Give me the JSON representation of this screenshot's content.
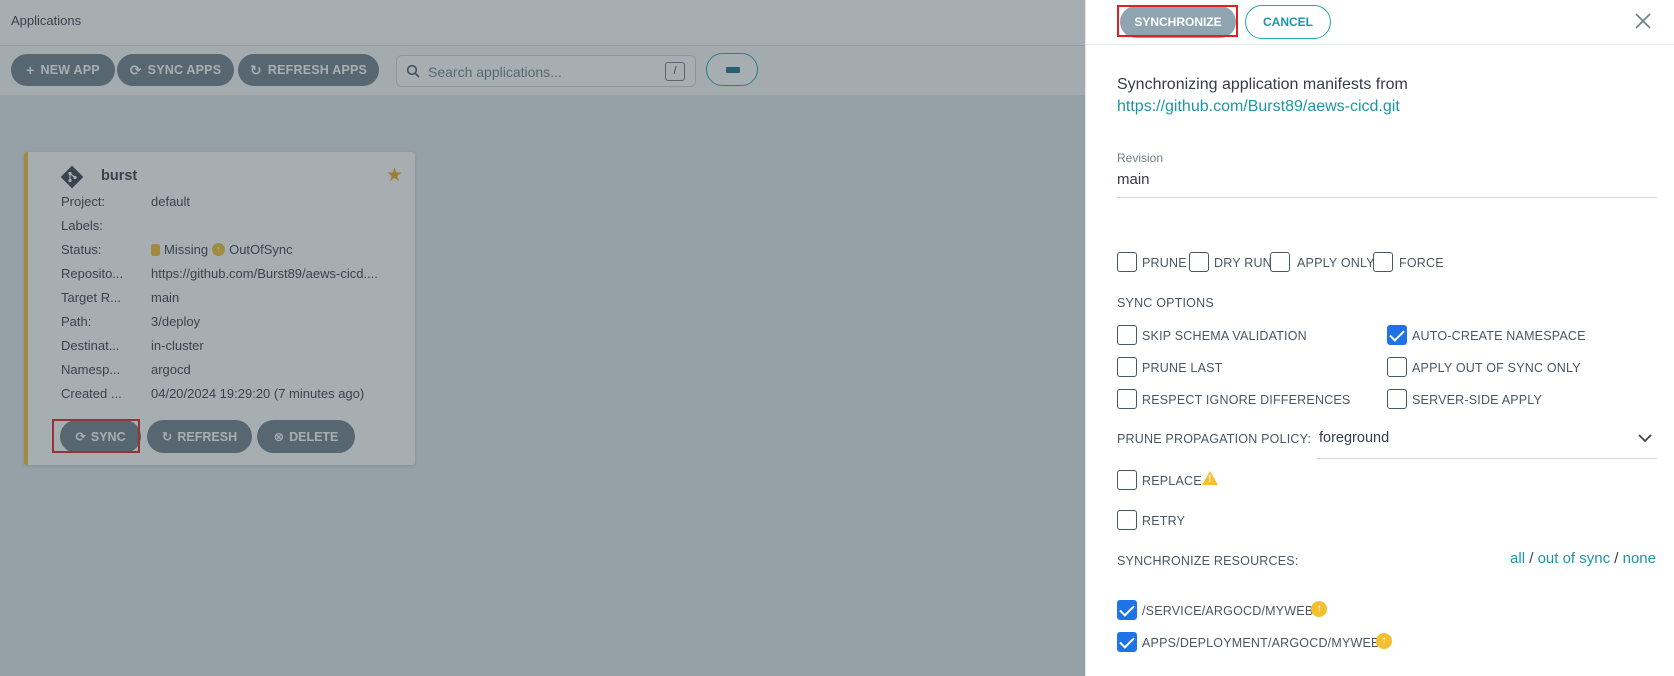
{
  "header": {
    "title": "Applications"
  },
  "toolbar": {
    "new_app": "NEW APP",
    "sync_apps": "SYNC APPS",
    "refresh_apps": "REFRESH APPS",
    "search_placeholder": "Search applications...",
    "search_shortcut": "/"
  },
  "app_card": {
    "name": "burst",
    "fields": [
      {
        "key": "Project:",
        "value": "default"
      },
      {
        "key": "Labels:",
        "value": ""
      },
      {
        "key": "Status:",
        "value": ""
      },
      {
        "key": "Reposito...",
        "value": "https://github.com/Burst89/aews-cicd...."
      },
      {
        "key": "Target R...",
        "value": "main"
      },
      {
        "key": "Path:",
        "value": "3/deploy"
      },
      {
        "key": "Destinat...",
        "value": "in-cluster"
      },
      {
        "key": "Namesp...",
        "value": "argocd"
      },
      {
        "key": "Created ...",
        "value": "04/20/2024 19:29:20  (7 minutes ago)"
      }
    ],
    "health_status": "Missing",
    "sync_status": "OutOfSync",
    "buttons": {
      "sync": "SYNC",
      "refresh": "REFRESH",
      "delete": "DELETE"
    }
  },
  "panel": {
    "synchronize": "SYNCHRONIZE",
    "cancel": "CANCEL",
    "intro": "Synchronizing application manifests from",
    "repo_url": "https://github.com/Burst89/aews-cicd.git",
    "revision_label": "Revision",
    "revision_value": "main",
    "top_options": [
      {
        "label": "PRUNE",
        "checked": false
      },
      {
        "label": "DRY RUN",
        "checked": false
      },
      {
        "label": "APPLY ONLY",
        "checked": false
      },
      {
        "label": "FORCE",
        "checked": false
      }
    ],
    "sync_options_title": "SYNC OPTIONS",
    "sync_options": [
      {
        "label": "SKIP SCHEMA VALIDATION",
        "checked": false
      },
      {
        "label": "AUTO-CREATE NAMESPACE",
        "checked": true
      },
      {
        "label": "PRUNE LAST",
        "checked": false
      },
      {
        "label": "APPLY OUT OF SYNC ONLY",
        "checked": false
      },
      {
        "label": "RESPECT IGNORE DIFFERENCES",
        "checked": false
      },
      {
        "label": "SERVER-SIDE APPLY",
        "checked": false
      }
    ],
    "prune_policy_label": "PRUNE PROPAGATION POLICY:",
    "prune_policy_value": "foreground",
    "replace_label": "REPLACE",
    "retry_label": "RETRY",
    "sync_resources_label": "SYNCHRONIZE RESOURCES:",
    "select_links": {
      "all": "all",
      "sep1": " / ",
      "out_of_sync": "out of sync",
      "sep2": " / ",
      "none": "none"
    },
    "resources": [
      {
        "label": "/SERVICE/ARGOCD/MYWEB",
        "checked": true
      },
      {
        "label": "APPS/DEPLOYMENT/ARGOCD/MYWEB",
        "checked": true
      }
    ]
  },
  "colors": {
    "accent": "#1a97a7",
    "warning": "#f4c030",
    "button": "#6d7f8b",
    "checkbox": "#1f73e8",
    "highlight": "#e02020"
  }
}
